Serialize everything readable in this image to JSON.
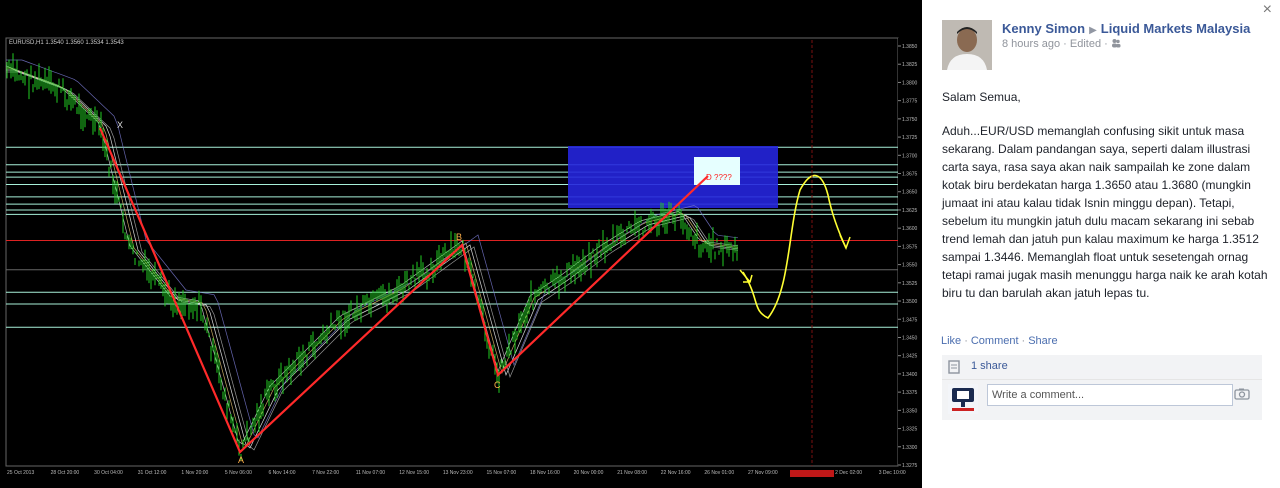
{
  "viewer": {
    "title": "EURUSD,H1  1.3540 1.3560 1.3534 1.3543",
    "y_ticks": [
      "1.3850",
      "1.3825",
      "1.3800",
      "1.3775",
      "1.3750",
      "1.3725",
      "1.3700",
      "1.3675",
      "1.3650",
      "1.3625",
      "1.3600",
      "1.3575",
      "1.3550",
      "1.3525",
      "1.3500",
      "1.3475",
      "1.3450",
      "1.3425",
      "1.3400",
      "1.3375",
      "1.3350",
      "1.3325",
      "1.3300",
      "1.3275"
    ],
    "x_ticks": [
      "25 Oct 2013",
      "28 Oct 20:00",
      "30 Oct 04:00",
      "31 Oct 12:00",
      "1 Nov 20:00",
      "5 Nov 06:00",
      "6 Nov 14:00",
      "7 Nov 22:00",
      "11 Nov 07:00",
      "12 Nov 15:00",
      "13 Nov 23:00",
      "15 Nov 07:00",
      "18 Nov 16:00",
      "20 Nov 00:00",
      "21 Nov 08:00",
      "22 Nov 16:00",
      "26 Nov 01:00",
      "27 Nov 09:00",
      "28 Nov 17:00",
      "2 Dec 02:00",
      "3 Dec 10:00"
    ],
    "wave_labels": [
      "X",
      "A",
      "B",
      "C",
      "D ????"
    ],
    "level_labels": [
      "1.3711",
      "1.3687",
      "1.3677",
      "1.3670",
      "1.3660",
      "1.3643",
      "1.3633",
      "1.3625",
      "1.3619",
      "1.3583",
      "1.3543",
      "1.3512",
      "1.3496",
      "1.3464"
    ],
    "colors": {
      "background": "#000000",
      "candles": "#22cc22",
      "zigzag": "#ff2222",
      "zone": "#2525dd",
      "levels": "#a7f0d9",
      "hand_drawn": "#ffff33"
    }
  },
  "post": {
    "author": "Kenny Simon",
    "group": "Liquid Markets Malaysia",
    "time": "8 hours ago",
    "edited": "Edited",
    "greeting": "Salam Semua,",
    "body": "Aduh...EUR/USD memanglah confusing sikit untuk masa sekarang. Dalam pandangan saya, seperti dalam illustrasi carta saya, rasa saya akan naik sampailah ke zone dalam kotak biru berdekatan harga 1.3650 atau 1.3680 (mungkin jumaat ini atau kalau tidak Isnin minggu depan). Tetapi, sebelum itu mungkin jatuh dulu macam sekarang ini sebab trend lemah dan jatuh pun kalau maximum ke harga 1.3512 sampai 1.3446. Memanglah float untuk sesetengah ornag tetapi ramai jugak masih menunggu harga naik ke arah kotah biru tu dan barulah akan jatuh lepas tu."
  },
  "actions": {
    "like": "Like",
    "comment": "Comment",
    "share": "Share"
  },
  "shares": {
    "count_label": "1 share"
  },
  "comment_box": {
    "placeholder": "Write a comment..."
  },
  "close_label": "×"
}
